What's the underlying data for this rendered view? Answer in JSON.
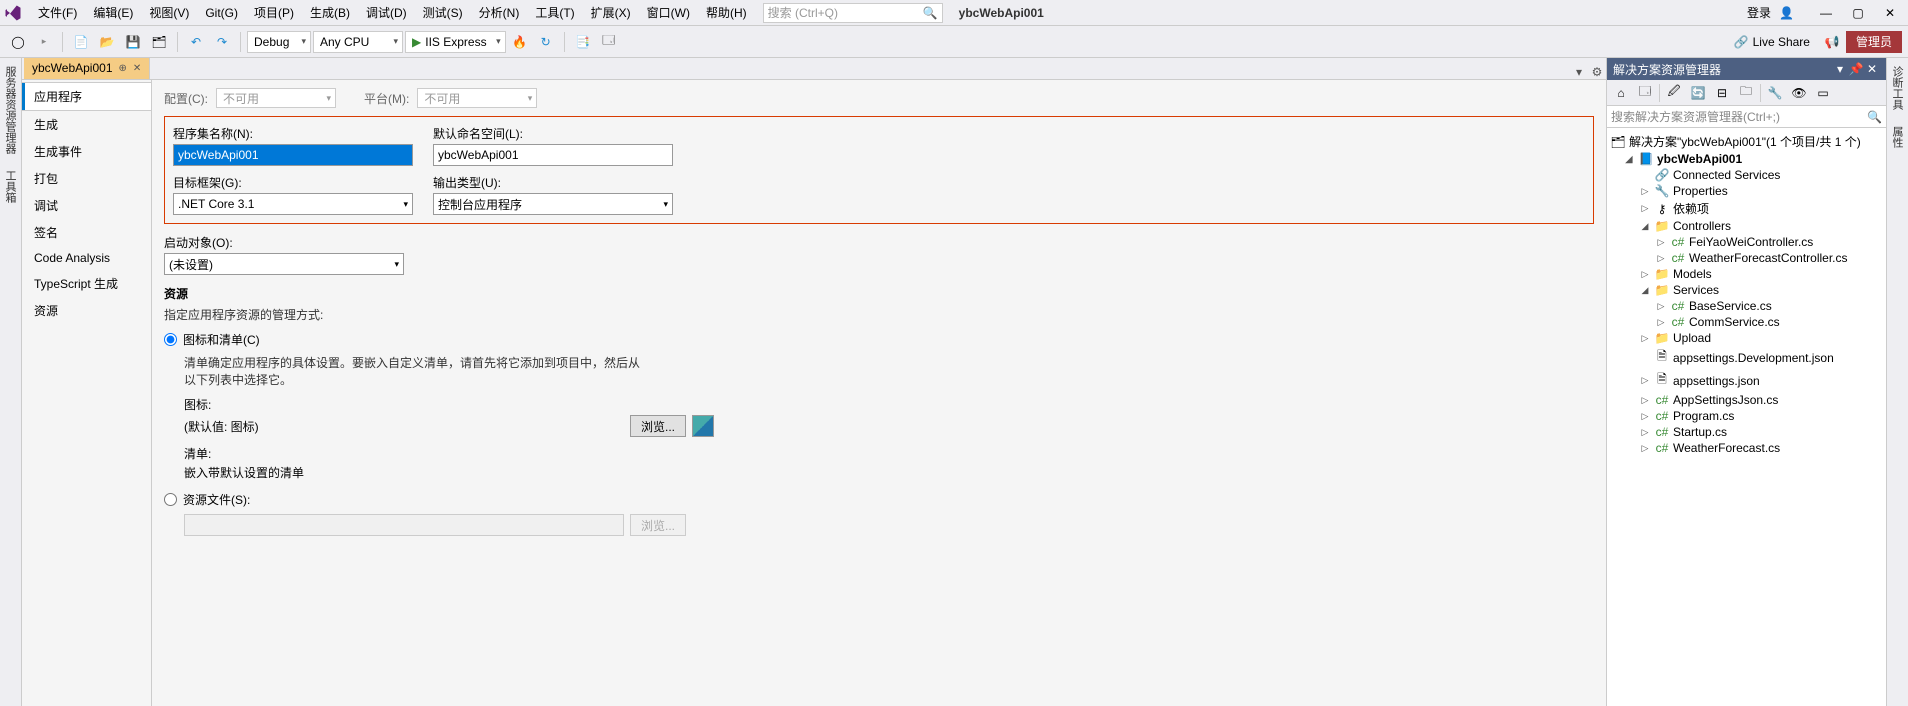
{
  "menu": [
    "文件(F)",
    "编辑(E)",
    "视图(V)",
    "Git(G)",
    "项目(P)",
    "生成(B)",
    "调试(D)",
    "测试(S)",
    "分析(N)",
    "工具(T)",
    "扩展(X)",
    "窗口(W)",
    "帮助(H)"
  ],
  "search_placeholder": "搜索 (Ctrl+Q)",
  "project_title": "ybcWebApi001",
  "login_label": "登录",
  "toolbar": {
    "config": "Debug",
    "platform": "Any CPU",
    "run_label": "IIS Express",
    "liveshare": "Live Share",
    "admin": "管理员"
  },
  "left_rails": [
    "服务器资源管理器",
    "工具箱"
  ],
  "right_rails": [
    "诊断工具",
    "属性"
  ],
  "doc_tab": "ybcWebApi001",
  "prop_nav": [
    "应用程序",
    "生成",
    "生成事件",
    "打包",
    "调试",
    "签名",
    "Code Analysis",
    "TypeScript 生成",
    "资源"
  ],
  "cfg": {
    "label": "配置(C):",
    "value": "不可用",
    "plat_label": "平台(M):",
    "plat_value": "不可用"
  },
  "fields": {
    "asm_label": "程序集名称(N):",
    "asm_value": "ybcWebApi001",
    "ns_label": "默认命名空间(L):",
    "ns_value": "ybcWebApi001",
    "fw_label": "目标框架(G):",
    "fw_value": ".NET Core 3.1",
    "out_label": "输出类型(U):",
    "out_value": "控制台应用程序",
    "startup_label": "启动对象(O):",
    "startup_value": "(未设置)"
  },
  "res": {
    "title": "资源",
    "hint": "指定应用程序资源的管理方式:",
    "radio1": "图标和清单(C)",
    "radio1_desc": "清单确定应用程序的具体设置。要嵌入自定义清单，请首先将它添加到项目中，然后从以下列表中选择它。",
    "icon_label": "图标:",
    "icon_value": "(默认值: 图标)",
    "browse": "浏览...",
    "manifest_label": "清单:",
    "manifest_value": "嵌入带默认设置的清单",
    "radio2": "资源文件(S):"
  },
  "sln": {
    "title": "解决方案资源管理器",
    "search_placeholder": "搜索解决方案资源管理器(Ctrl+;)",
    "root": "解决方案\"ybcWebApi001\"(1 个项目/共 1 个)",
    "proj": "ybcWebApi001",
    "nodes": {
      "connected": "Connected Services",
      "properties": "Properties",
      "deps": "依赖项",
      "controllers": "Controllers",
      "c1": "FeiYaoWeiController.cs",
      "c2": "WeatherForecastController.cs",
      "models": "Models",
      "services": "Services",
      "s1": "BaseService.cs",
      "s2": "CommService.cs",
      "upload": "Upload",
      "app1": "appsettings.Development.json",
      "app2": "appsettings.json",
      "f1": "AppSettingsJson.cs",
      "f2": "Program.cs",
      "f3": "Startup.cs",
      "f4": "WeatherForecast.cs"
    }
  }
}
